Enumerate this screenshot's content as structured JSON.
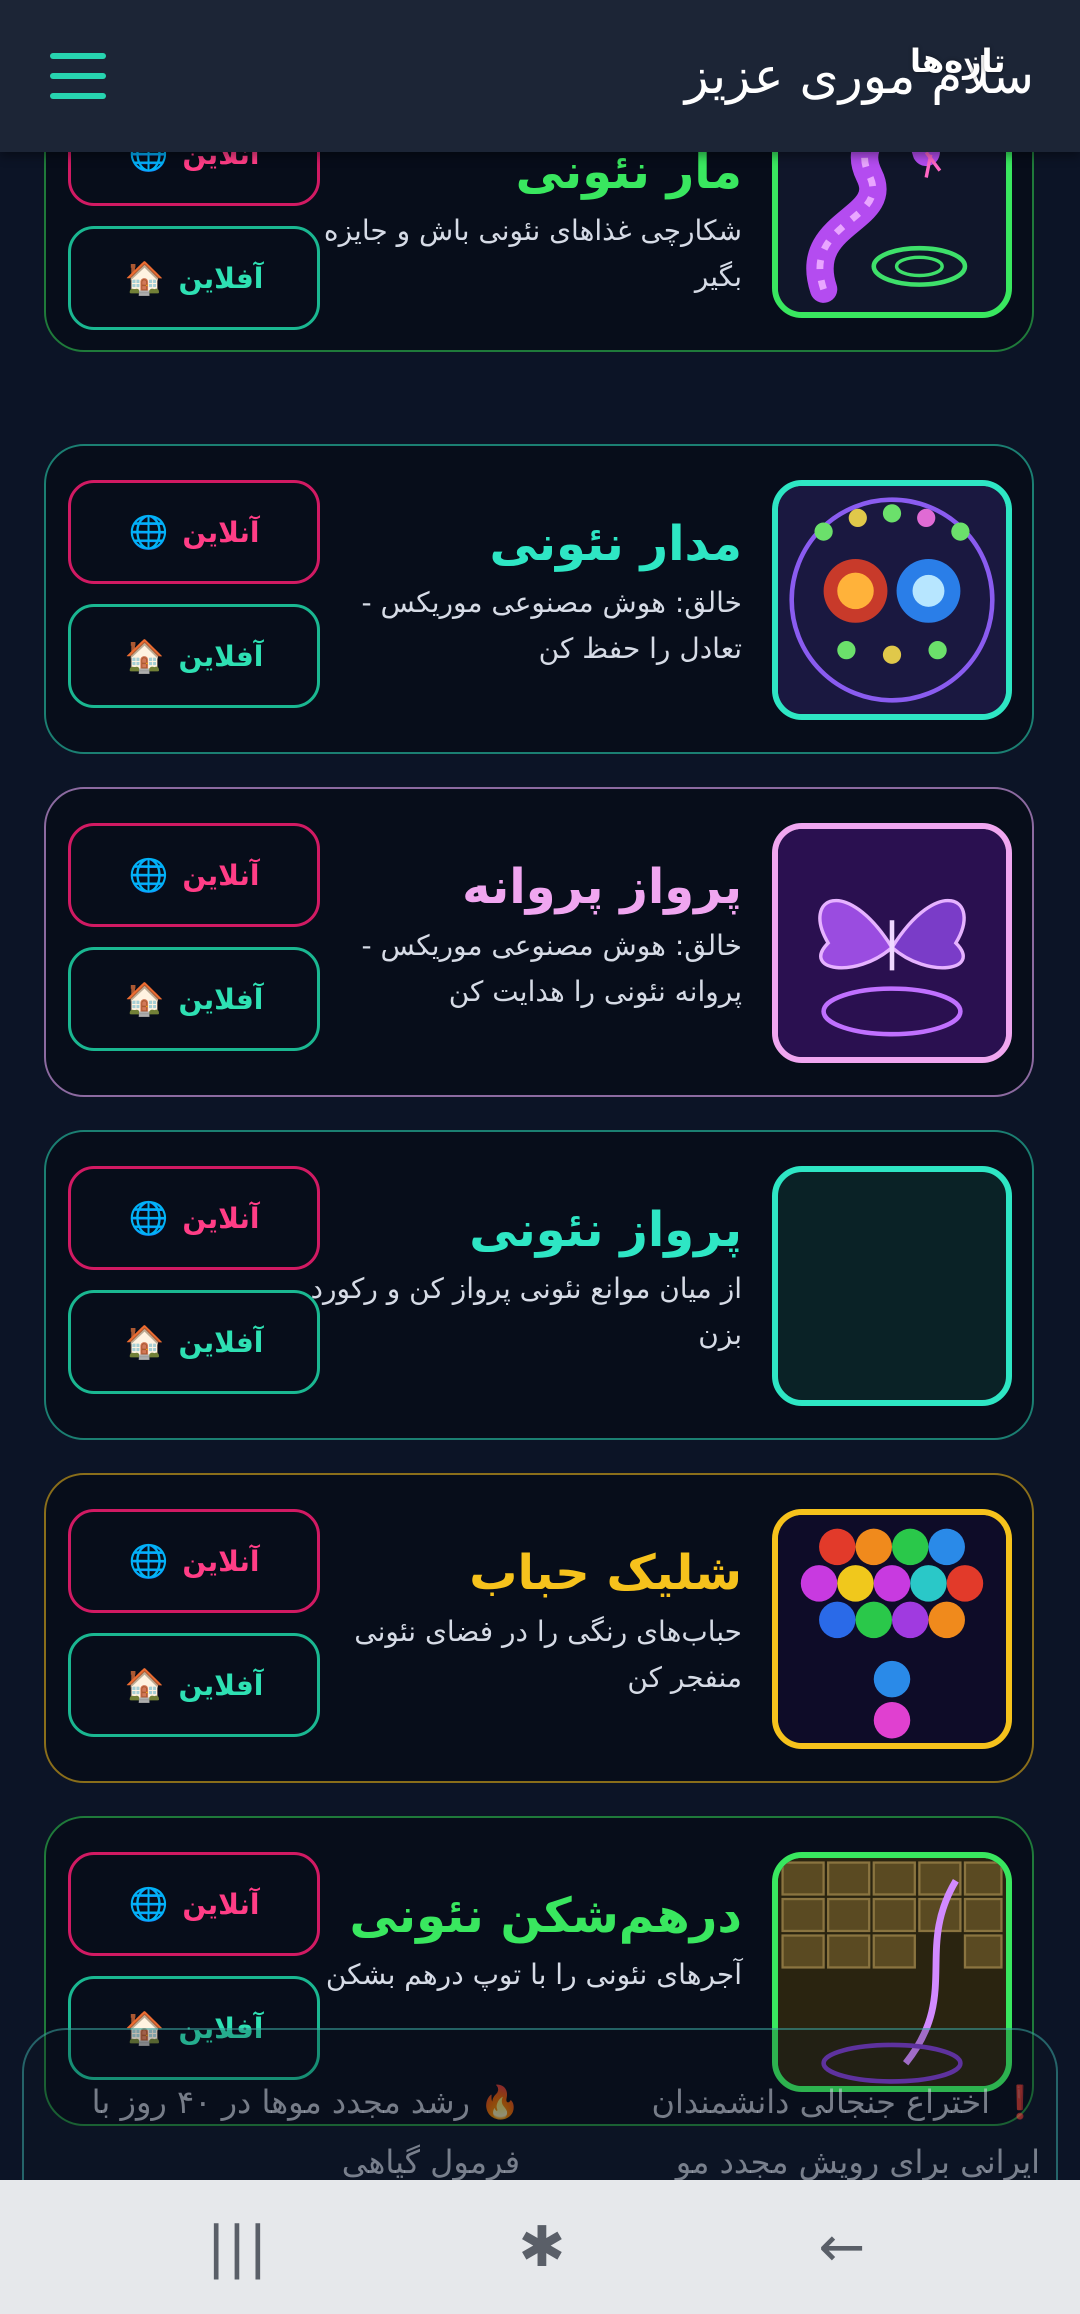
{
  "header": {
    "greeting": "سلام موری عزیز"
  },
  "buttons": {
    "online": "آنلاین",
    "offline": "آفلاین",
    "online_icon": "globe-icon",
    "offline_icon": "house-icon"
  },
  "games": [
    {
      "title": "مار نئونی",
      "description": "شکارچی غذاهای نئونی باش و جایزه بگیر",
      "accent": "#39e75f",
      "border": "#1f7a3a",
      "thumb": "snake"
    },
    {
      "title": "مدار نئونی",
      "description": "خالق: هوش مصنوعی موریکس - تعادل را حفظ کن",
      "accent": "#2ee6c4",
      "border": "#1b7f72",
      "thumb": "orbit"
    },
    {
      "title": "پرواز پروانه",
      "description": "خالق: هوش مصنوعی موریکس - پروانه نئونی را هدایت کن",
      "accent": "#f0a6f0",
      "border": "#8c6aa0",
      "thumb": "butterfly"
    },
    {
      "title": "پرواز نئونی",
      "description": "از میان موانع نئونی پرواز کن و رکورد بزن",
      "accent": "#2ee6c4",
      "border": "#1b7f72",
      "thumb": "empty"
    },
    {
      "title": "شلیک حباب",
      "description": "حباب‌های رنگی را در فضای نئونی منفجر کن",
      "accent": "#f6c21c",
      "border": "#8a6e1a",
      "thumb": "bubbles"
    },
    {
      "title": "درهم‌شکن نئونی",
      "description": "آجرهای نئونی را با توپ درهم بشکن",
      "accent": "#39e75f",
      "border": "#1f7a3a",
      "thumb": "bricks"
    }
  ],
  "news": {
    "item1": "❗ اختراع جنجالی دانشمندان ایرانی برای رویش مجدد مو",
    "item2": "🔥 رشد مجدد موها در ۴۰ روز با فرمول گیاهی"
  },
  "navbar": {
    "recent": "|||",
    "home": "✱",
    "back": "←",
    "news_label": "تازه‌ها"
  }
}
